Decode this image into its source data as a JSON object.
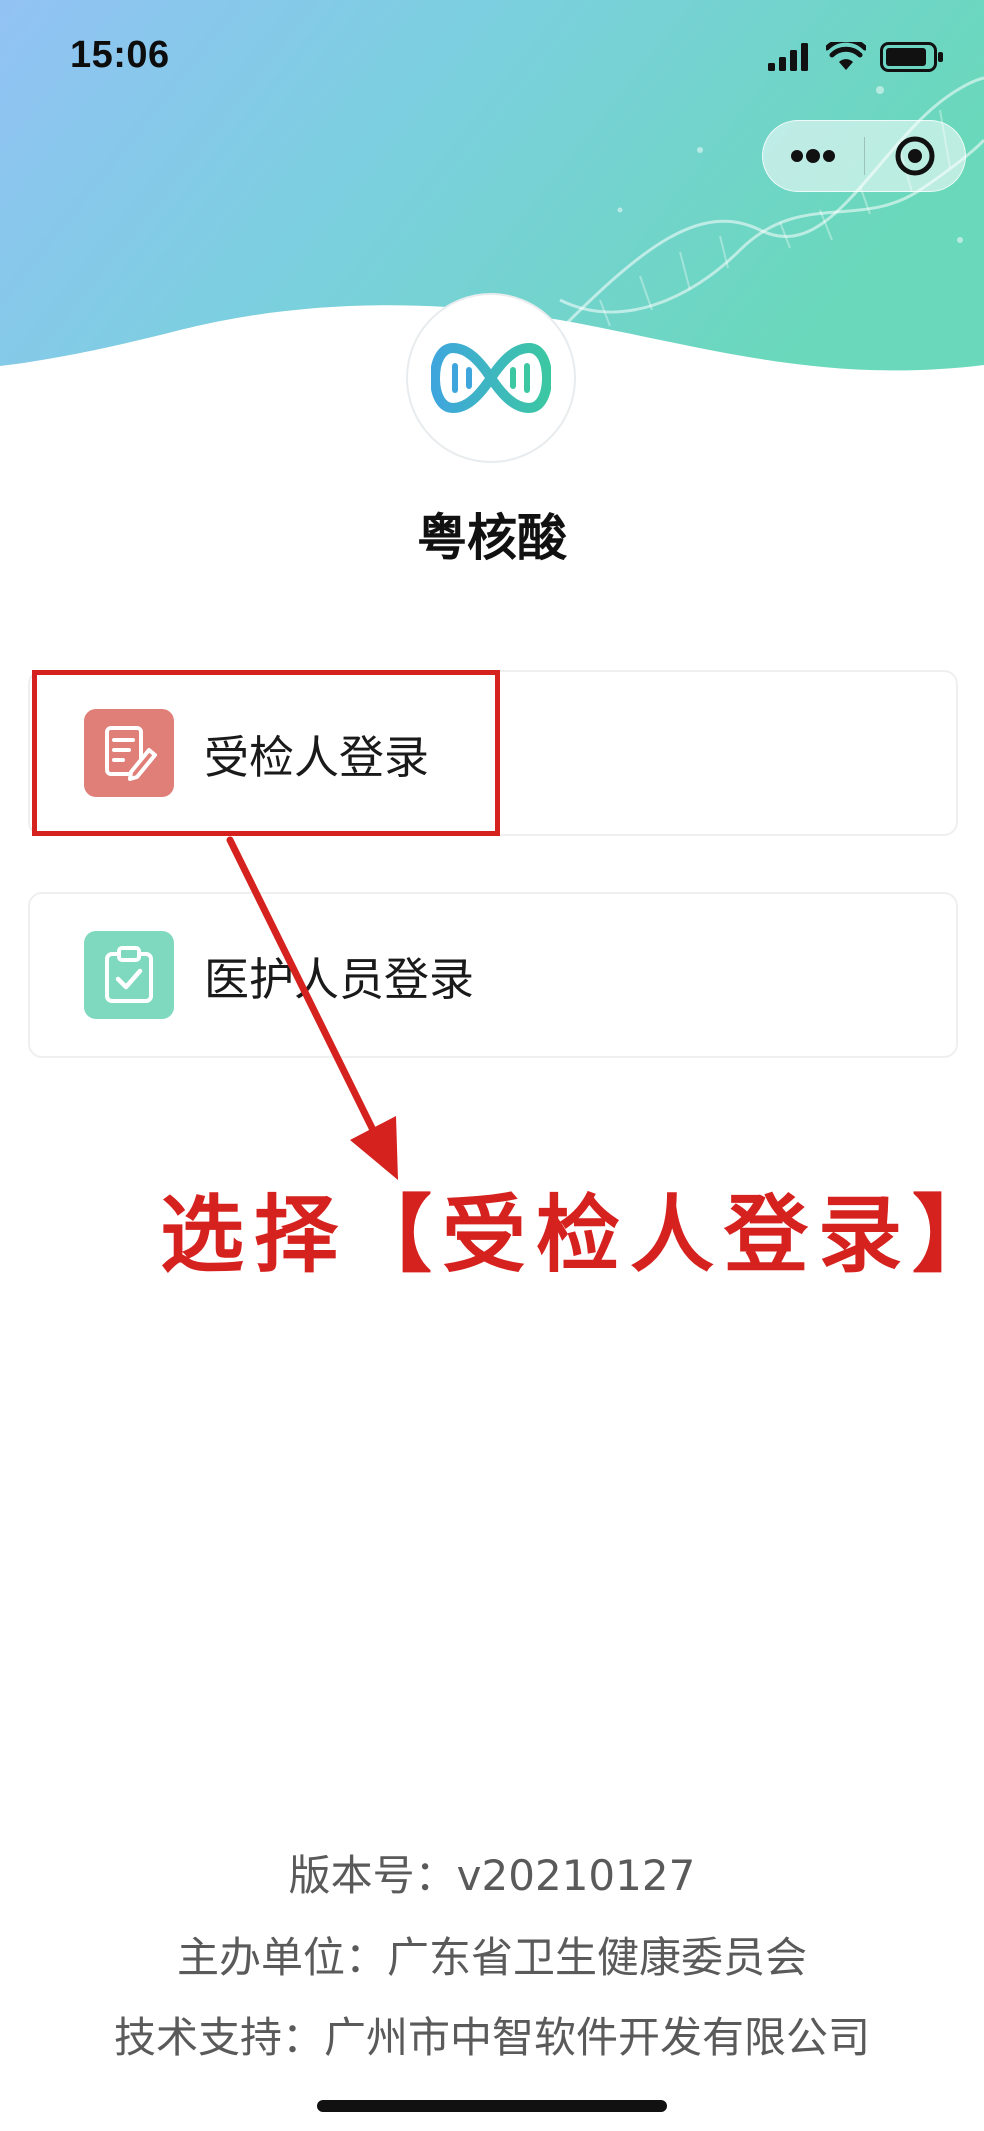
{
  "status_bar": {
    "time": "15:06"
  },
  "capsule": {
    "more_icon": "more-dots-icon",
    "close_icon": "target-close-icon"
  },
  "app": {
    "title": "粤核酸"
  },
  "login_options": [
    {
      "label": "受检人登录",
      "icon": "form-edit-icon",
      "icon_color": "#e07e78"
    },
    {
      "label": "医护人员登录",
      "icon": "clipboard-check-icon",
      "icon_color": "#7ed9bf"
    }
  ],
  "annotation": {
    "text": "选择【受检人登录】",
    "color": "#d6221f"
  },
  "footer": {
    "version": "版本号：v20210127",
    "sponsor": "主办单位：广东省卫生健康委员会",
    "support": "技术支持：广州市中智软件开发有限公司"
  },
  "colors": {
    "header_gradient_start": "#8fc3f2",
    "header_gradient_end": "#6fd8bf"
  }
}
